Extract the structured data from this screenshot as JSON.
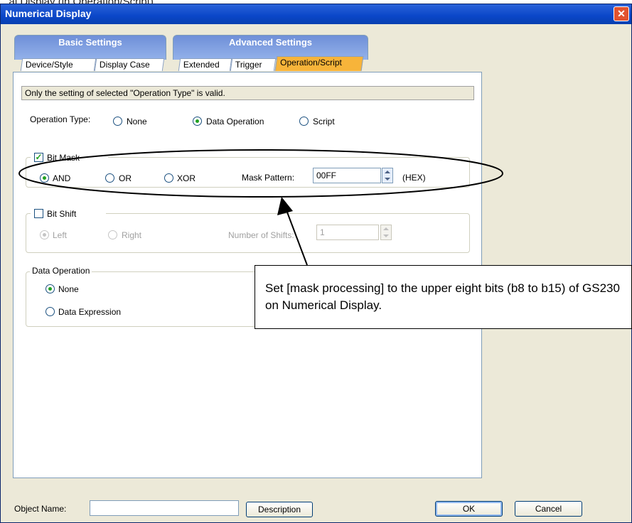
{
  "caption": "...al Display (in Operation/Script)",
  "window": {
    "title": "Numerical Display",
    "close_glyph": "✕"
  },
  "tab_groups": [
    {
      "label": "Basic Settings",
      "tabs": [
        "Device/Style",
        "Display Case"
      ]
    },
    {
      "label": "Advanced Settings",
      "tabs": [
        "Extended",
        "Trigger",
        "Operation/Script"
      ]
    }
  ],
  "active_tab": "Operation/Script",
  "info_text": "Only the setting of selected  \"Operation Type\" is valid.",
  "operation_type": {
    "label": "Operation Type:",
    "options": [
      "None",
      "Data Operation",
      "Script"
    ],
    "selected": "Data Operation"
  },
  "bit_mask": {
    "label": "Bit Mask",
    "checked": true,
    "options": [
      "AND",
      "OR",
      "XOR"
    ],
    "selected": "AND",
    "pattern_label": "Mask Pattern:",
    "pattern_value": "00FF",
    "unit": "(HEX)"
  },
  "bit_shift": {
    "label": "Bit Shift",
    "checked": false,
    "options": [
      "Left",
      "Right"
    ],
    "selected": "Left",
    "shifts_label": "Number of Shifts:",
    "shifts_value": "1"
  },
  "data_operation": {
    "label": "Data Operation",
    "options": [
      "None",
      "Data Expression"
    ],
    "selected": "None"
  },
  "footer": {
    "object_name_label": "Object Name:",
    "object_name_value": "",
    "description_button": "Description",
    "ok_button": "OK",
    "cancel_button": "Cancel"
  },
  "annotation": {
    "text": "Set [mask processing] to the upper eight bits (b8 to b15) of GS230 on Numerical Display."
  }
}
